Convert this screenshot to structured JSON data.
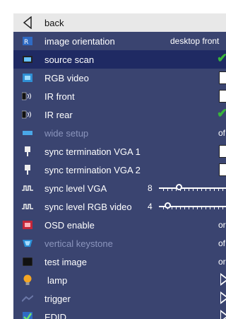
{
  "menu": {
    "back": {
      "label": "back",
      "icon": "back-arrow-icon"
    },
    "rows": [
      {
        "key": "image_orientation",
        "label": "image orientation",
        "icon": "orientation-icon",
        "value": "desktop front"
      },
      {
        "key": "source_scan",
        "label": "source scan",
        "icon": "source-scan-icon",
        "checked": true
      },
      {
        "key": "rgb_video",
        "label": "RGB video",
        "icon": "rgb-video-icon",
        "checked": false
      },
      {
        "key": "ir_front",
        "label": "IR front",
        "icon": "ir-front-icon",
        "checked": false
      },
      {
        "key": "ir_rear",
        "label": "IR rear",
        "icon": "ir-rear-icon",
        "checked": true
      },
      {
        "key": "wide_setup",
        "label": "wide setup",
        "icon": "wide-setup-icon",
        "value": "of",
        "disabled": true
      },
      {
        "key": "sync_term_vga1",
        "label": "sync termination VGA 1",
        "icon": "sync-termination-icon",
        "checked": false
      },
      {
        "key": "sync_term_vga2",
        "label": "sync termination VGA 2",
        "icon": "sync-termination-icon",
        "checked": false
      },
      {
        "key": "sync_level_vga",
        "label": "sync level VGA",
        "icon": "sync-level-icon",
        "slider_value": "8",
        "slider_level": 0.25
      },
      {
        "key": "sync_level_rgb",
        "label": "sync level RGB video",
        "icon": "sync-level-icon",
        "slider_value": "4",
        "slider_level": 0.08
      },
      {
        "key": "osd_enable",
        "label": "OSD enable",
        "icon": "osd-icon",
        "value": "or"
      },
      {
        "key": "vertical_keystone",
        "label": "vertical keystone",
        "icon": "keystone-icon",
        "value": "of",
        "disabled": true
      },
      {
        "key": "test_image",
        "label": "test image",
        "icon": "test-image-icon",
        "value": "or"
      },
      {
        "key": "lamp",
        "label": "lamp",
        "icon": "lamp-icon",
        "submenu": true
      },
      {
        "key": "trigger",
        "label": "trigger",
        "icon": "trigger-icon",
        "submenu": true
      },
      {
        "key": "edid",
        "label": "EDID",
        "icon": "edid-icon",
        "submenu": true
      }
    ]
  },
  "colors": {
    "panel": "#3a4470",
    "highlight": "#1f2a63",
    "check": "#38b53a",
    "disabled_text": "#8b95bd"
  }
}
